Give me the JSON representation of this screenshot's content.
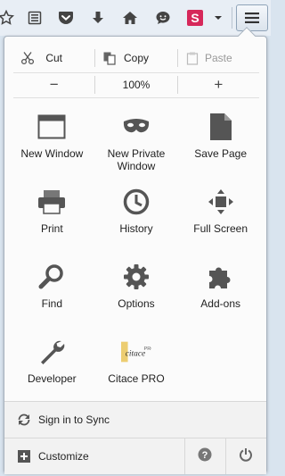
{
  "toolbar": {
    "icons": [
      "star-icon",
      "reading-list-icon",
      "pocket-icon",
      "download-icon",
      "home-icon",
      "emoji-icon",
      "s-extension-icon",
      "dropdown-icon",
      "hamburger-menu-icon"
    ],
    "colors": {
      "pocket": "#444444",
      "extension_bg": "#d6285a"
    }
  },
  "panel": {
    "edit": {
      "cut": "Cut",
      "copy": "Copy",
      "paste": "Paste"
    },
    "zoom": {
      "minus": "−",
      "level": "100%",
      "plus": "+"
    },
    "items": [
      {
        "label": "New Window",
        "icon": "new-window-icon"
      },
      {
        "label": "New Private Window",
        "icon": "private-mask-icon"
      },
      {
        "label": "Save Page",
        "icon": "save-page-icon"
      },
      {
        "label": "Print",
        "icon": "print-icon"
      },
      {
        "label": "History",
        "icon": "history-clock-icon"
      },
      {
        "label": "Full Screen",
        "icon": "full-screen-icon"
      },
      {
        "label": "Find",
        "icon": "find-magnifier-icon"
      },
      {
        "label": "Options",
        "icon": "options-gear-icon"
      },
      {
        "label": "Add-ons",
        "icon": "addons-puzzle-icon"
      },
      {
        "label": "Developer",
        "icon": "developer-wrench-icon"
      },
      {
        "label": "Citace PRO",
        "icon": "citace-pro-logo"
      }
    ],
    "sync_label": "Sign in to Sync",
    "customize_label": "Customize",
    "citace_logo_text": "citace PRO"
  }
}
